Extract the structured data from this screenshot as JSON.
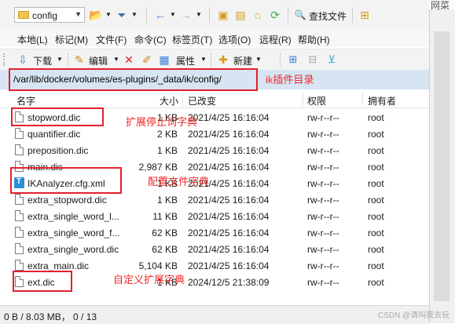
{
  "toolbar": {
    "folder_combo_value": "config",
    "find_files_label": "查找文件"
  },
  "menu": [
    "本地(L)",
    "标记(M)",
    "文件(F)",
    "命令(C)",
    "标签页(T)",
    "选项(O)",
    "远程(R)",
    "帮助(H)"
  ],
  "actions": {
    "download": "下载",
    "edit": "编辑",
    "properties": "属性",
    "new": "新建"
  },
  "path": "/var/lib/docker/volumes/es-plugins/_data/ik/config/",
  "columns": {
    "name": "名字",
    "size": "大小",
    "modified": "已改变",
    "permissions": "权限",
    "owner": "拥有者"
  },
  "files": [
    {
      "name": "stopword.dic",
      "size": "1 KB",
      "modified": "2021/4/25 16:16:04",
      "perm": "rw-r--r--",
      "owner": "root",
      "icon": "file"
    },
    {
      "name": "quantifier.dic",
      "size": "2 KB",
      "modified": "2021/4/25 16:16:04",
      "perm": "rw-r--r--",
      "owner": "root",
      "icon": "file"
    },
    {
      "name": "preposition.dic",
      "size": "1 KB",
      "modified": "2021/4/25 16:16:04",
      "perm": "rw-r--r--",
      "owner": "root",
      "icon": "file"
    },
    {
      "name": "main.dic",
      "size": "2,987 KB",
      "modified": "2021/4/25 16:16:04",
      "perm": "rw-r--r--",
      "owner": "root",
      "icon": "file"
    },
    {
      "name": "IKAnalyzer.cfg.xml",
      "size": "1 KB",
      "modified": "2021/4/25 16:16:04",
      "perm": "rw-r--r--",
      "owner": "root",
      "icon": "xml"
    },
    {
      "name": "extra_stopword.dic",
      "size": "1 KB",
      "modified": "2021/4/25 16:16:04",
      "perm": "rw-r--r--",
      "owner": "root",
      "icon": "file"
    },
    {
      "name": "extra_single_word_l...",
      "size": "11 KB",
      "modified": "2021/4/25 16:16:04",
      "perm": "rw-r--r--",
      "owner": "root",
      "icon": "file"
    },
    {
      "name": "extra_single_word_f...",
      "size": "62 KB",
      "modified": "2021/4/25 16:16:04",
      "perm": "rw-r--r--",
      "owner": "root",
      "icon": "file"
    },
    {
      "name": "extra_single_word.dic",
      "size": "62 KB",
      "modified": "2021/4/25 16:16:04",
      "perm": "rw-r--r--",
      "owner": "root",
      "icon": "file"
    },
    {
      "name": "extra_main.dic",
      "size": "5,104 KB",
      "modified": "2021/4/25 16:16:04",
      "perm": "rw-r--r--",
      "owner": "root",
      "icon": "file"
    },
    {
      "name": "ext.dic",
      "size": "1 KB",
      "modified": "2024/12/5 21:38:09",
      "perm": "rw-r--r--",
      "owner": "root",
      "icon": "file"
    }
  ],
  "annotations": {
    "path_note": "ik插件目录",
    "stopword_note": "扩展停止词字典",
    "config_note": "配置文件字典",
    "ext_note": "自定义扩展字典"
  },
  "status": "0 B / 8.03 MB， 0 / 13",
  "watermark": "CSDN @请叫我去玩",
  "corner_text": "网菜",
  "accent_color": "#e3202d",
  "path_bar_color": "#d7e4f2"
}
